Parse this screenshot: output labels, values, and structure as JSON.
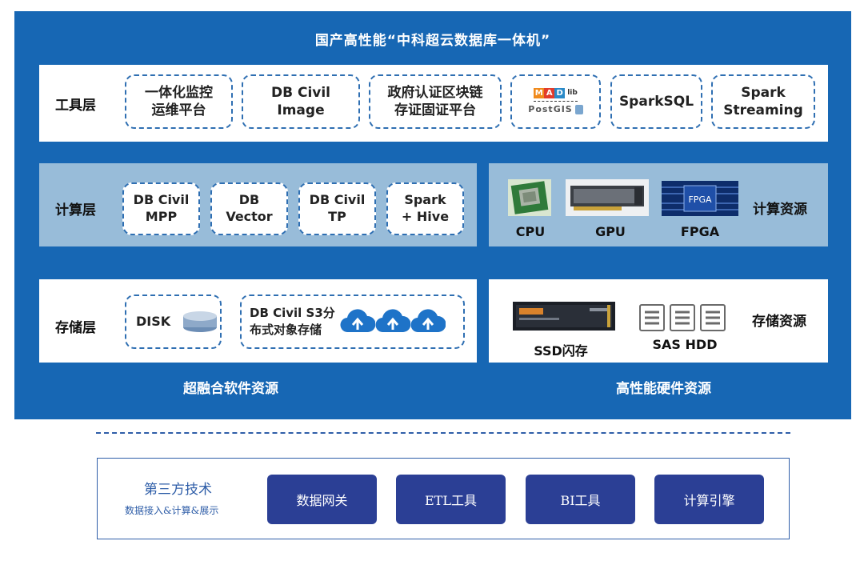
{
  "title": "国产高性能“中科超云数据库一体机”",
  "tool_layer": {
    "label": "工具层",
    "boxes": [
      {
        "line1": "一体化监控",
        "line2": "运维平台"
      },
      {
        "line1": "DB Civil",
        "line2": "Image"
      },
      {
        "line1": "政府认证区块链",
        "line2": "存证固证平台"
      },
      {
        "logo_top": "MADlib",
        "logo_bottom": "PostGIS"
      },
      {
        "line1": "SparkSQL",
        "line2": ""
      },
      {
        "line1": "Spark",
        "line2": "Streaming"
      }
    ]
  },
  "compute_layer": {
    "label": "计算层",
    "boxes": [
      {
        "line1": "DB Civil",
        "line2": "MPP"
      },
      {
        "line1": "DB",
        "line2": "Vector"
      },
      {
        "line1": "DB Civil",
        "line2": "TP"
      },
      {
        "line1": "Spark",
        "line2": "+ Hive"
      }
    ]
  },
  "compute_resources": {
    "label": "计算资源",
    "items": [
      "CPU",
      "GPU",
      "FPGA"
    ],
    "fpga_chip_text": "FPGA"
  },
  "storage_layer": {
    "label": "存储层",
    "disk_label": "DISK",
    "s3_line1": "DB Civil S3分",
    "s3_line2": "布式对象存储"
  },
  "storage_resources": {
    "label": "存储资源",
    "items": [
      "SSD闪存",
      "SAS HDD"
    ]
  },
  "captions": {
    "software": "超融合软件资源",
    "hardware": "高性能硬件资源"
  },
  "third_party": {
    "title": "第三方技术",
    "subtitle": "数据接入&计算&展示",
    "buttons": [
      "数据网关",
      "ETL工具",
      "BI工具",
      "计算引擎"
    ]
  },
  "colors": {
    "panel_blue": "#1767b4",
    "light_blue": "#98bcd9",
    "dashed_border": "#2f6fb2",
    "button_navy": "#2b3f95",
    "cloud_blue": "#1e73c8"
  }
}
